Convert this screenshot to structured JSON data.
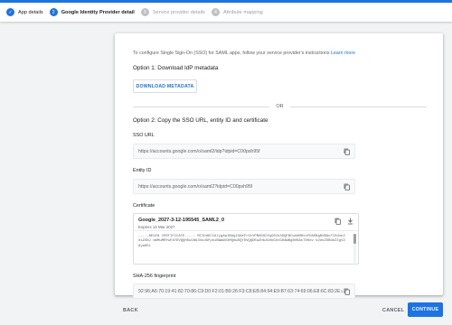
{
  "stepper": {
    "steps": [
      {
        "label": "App details",
        "state": "done",
        "marker": "✓"
      },
      {
        "label": "Google Identity Provider detail",
        "state": "active",
        "marker": "2"
      },
      {
        "label": "Service provider details",
        "state": "todo",
        "marker": "3"
      },
      {
        "label": "Attribute mapping",
        "state": "todo",
        "marker": "4"
      }
    ]
  },
  "main": {
    "intro_text": "To configure Single Sign-On (SSO) for SAML apps, follow your service provider's instructions",
    "intro_link": "Learn more",
    "option1_title": "Option 1: Download IdP metadata",
    "download_button": "DOWNLOAD METADATA",
    "or_text": "OR",
    "option2_title": "Option 2: Copy the SSO URL, entity ID and certificate",
    "sso_url": {
      "label": "SSO URL",
      "value": "https://accounts.google.com/o/saml2/idp?idpid=C00psh95f"
    },
    "entity_id": {
      "label": "Entity ID",
      "value": "https://accounts.google.com/o/saml2?idpid=C00psh95f"
    },
    "certificate": {
      "label": "Certificate",
      "name": "Google_2027-3-12-195545_SAML2_0",
      "expiry": "Expires 13 Mar 2027",
      "body": "-----BEGIN CERTIFICATE----- MIIDdDCCAlygAwIBAgIGAXFrGtVPMA0GCSqGSIb3DQEBCwUAMHsxFDASBgNVBAoTC0dvb2dsZSBJ bmMuMRYwFAYDVQQHEw1Nb3VudGFpbiBWaWV3MQ8wDQYDVQQDEwZHb29nbGUxGDAWBgNVBAsTD0dv b2dsZSBGb3IgV29ya0EL"
    },
    "fingerprint": {
      "label": "SHA-256 fingerprint",
      "value": "92:96:A6:70:19:41:82:70:86:C9:D0:F2:01:B9:26:F3:C8:EB:84:94:E9:B7:63:74:69:06:E8:6C:83:2E:A9:57"
    }
  },
  "footer": {
    "back": "BACK",
    "cancel": "CANCEL",
    "continue": "CONTINUE"
  },
  "colors": {
    "accent": "#1a73e8",
    "background": "#f1f3f4"
  },
  "icons": {
    "copy": "copy-icon",
    "download": "download-icon",
    "check": "check-icon"
  }
}
